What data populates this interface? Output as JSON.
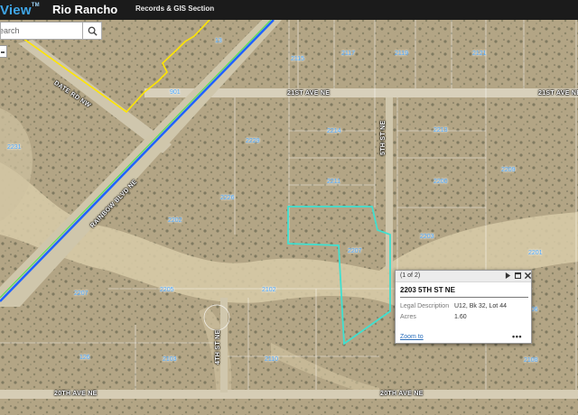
{
  "header": {
    "logo_text": "View",
    "logo_sup": "TM",
    "city": "Rio Rancho",
    "section": "Records & GIS Section"
  },
  "search": {
    "placeholder": "earch",
    "icon": "search-icon"
  },
  "map": {
    "roads": {
      "date_rd": "DATE RD NW",
      "rainbow": "RAINBOW BLVD NE",
      "ave21_a": "21ST AVE NE",
      "ave21_b": "21ST AVE NE",
      "st5": "5TH ST NE",
      "st4": "4TH ST NE",
      "ave20_a": "20TH AVE NE",
      "ave20_b": "20TH AVE NE"
    },
    "parcel_labels": [
      "13",
      "901",
      "2115",
      "2117",
      "2119",
      "2121",
      "2231",
      "2229",
      "2214",
      "2213",
      "2211",
      "2226",
      "2200",
      "2209",
      "2202",
      "2203",
      "2207",
      "2201",
      "2207",
      "2205",
      "2102",
      "2103",
      "2110",
      "2108",
      "2106",
      "126"
    ]
  },
  "popup": {
    "count": "(1 of 2)",
    "title": "2203 5TH ST NE",
    "fields": [
      {
        "key": "Legal Description",
        "value": "U12, Bk 32, Lot 44"
      },
      {
        "key": "Acres",
        "value": "1.60"
      }
    ],
    "zoom_link": "Zoom to",
    "more": "•••"
  },
  "colors": {
    "header_bg": "#1b1b1b",
    "logo_blue": "#3fa6e8",
    "parcel_label": "#4aa8ff",
    "highlight_parcel": "#40e0d0",
    "boundary_yellow": "#ffe600",
    "rainbow_line_blue": "#1e63ff",
    "rainbow_line_green": "#55e055"
  }
}
